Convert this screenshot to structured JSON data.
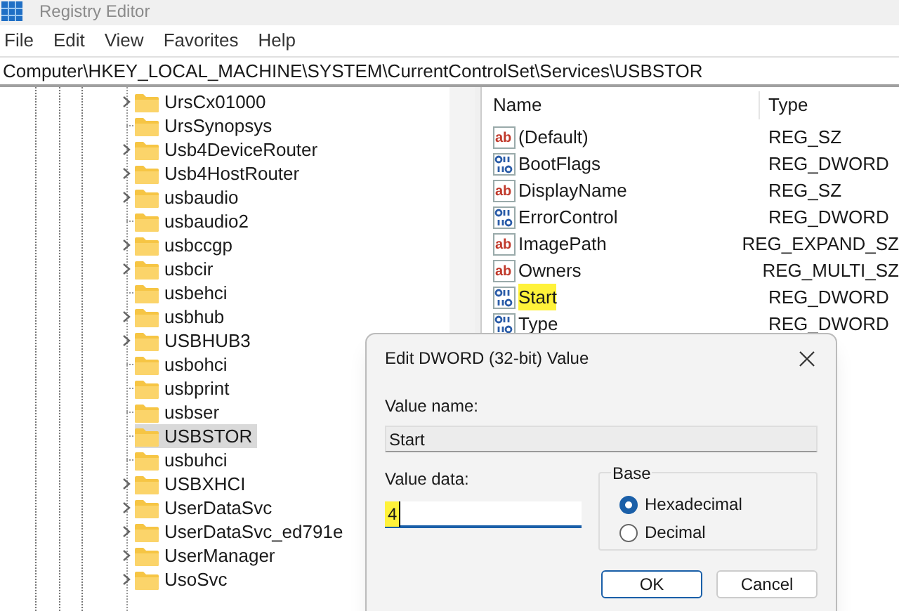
{
  "window": {
    "title": "Registry Editor"
  },
  "menu": [
    "File",
    "Edit",
    "View",
    "Favorites",
    "Help"
  ],
  "address": "Computer\\HKEY_LOCAL_MACHINE\\SYSTEM\\CurrentControlSet\\Services\\USBSTOR",
  "tree": {
    "items": [
      {
        "label": "UrsCx01000",
        "expandable": true,
        "selected": false
      },
      {
        "label": "UrsSynopsys",
        "expandable": false,
        "selected": false
      },
      {
        "label": "Usb4DeviceRouter",
        "expandable": true,
        "selected": false
      },
      {
        "label": "Usb4HostRouter",
        "expandable": true,
        "selected": false
      },
      {
        "label": "usbaudio",
        "expandable": true,
        "selected": false
      },
      {
        "label": "usbaudio2",
        "expandable": false,
        "selected": false
      },
      {
        "label": "usbccgp",
        "expandable": true,
        "selected": false
      },
      {
        "label": "usbcir",
        "expandable": true,
        "selected": false
      },
      {
        "label": "usbehci",
        "expandable": false,
        "selected": false
      },
      {
        "label": "usbhub",
        "expandable": true,
        "selected": false
      },
      {
        "label": "USBHUB3",
        "expandable": true,
        "selected": false
      },
      {
        "label": "usbohci",
        "expandable": false,
        "selected": false
      },
      {
        "label": "usbprint",
        "expandable": false,
        "selected": false
      },
      {
        "label": "usbser",
        "expandable": false,
        "selected": false
      },
      {
        "label": "USBSTOR",
        "expandable": false,
        "selected": true
      },
      {
        "label": "usbuhci",
        "expandable": false,
        "selected": false
      },
      {
        "label": "USBXHCI",
        "expandable": true,
        "selected": false
      },
      {
        "label": "UserDataSvc",
        "expandable": true,
        "selected": false
      },
      {
        "label": "UserDataSvc_ed791e",
        "expandable": true,
        "selected": false
      },
      {
        "label": "UserManager",
        "expandable": true,
        "selected": false
      },
      {
        "label": "UsoSvc",
        "expandable": true,
        "selected": false
      }
    ]
  },
  "values": {
    "columns": [
      "Name",
      "Type"
    ],
    "rows": [
      {
        "kind": "string",
        "icon_text": "ab",
        "name": "(Default)",
        "type": "REG_SZ",
        "highlighted": false
      },
      {
        "kind": "binary",
        "name": "BootFlags",
        "type": "REG_DWORD",
        "highlighted": false
      },
      {
        "kind": "string",
        "icon_text": "ab",
        "name": "DisplayName",
        "type": "REG_SZ",
        "highlighted": false
      },
      {
        "kind": "binary",
        "name": "ErrorControl",
        "type": "REG_DWORD",
        "highlighted": false
      },
      {
        "kind": "string",
        "icon_text": "ab",
        "name": "ImagePath",
        "type": "REG_EXPAND_SZ",
        "highlighted": false
      },
      {
        "kind": "string",
        "icon_text": "ab",
        "name": "Owners",
        "type": "REG_MULTI_SZ",
        "highlighted": false
      },
      {
        "kind": "binary",
        "name": "Start",
        "type": "REG_DWORD",
        "highlighted": true
      },
      {
        "kind": "binary",
        "name": "Type",
        "type": "REG_DWORD",
        "highlighted": false
      }
    ]
  },
  "dialog": {
    "title": "Edit DWORD (32-bit) Value",
    "value_name_label": "Value name:",
    "value_name": "Start",
    "value_data_label": "Value data:",
    "value_data": "4",
    "value_data_highlighted": true,
    "base": {
      "label": "Base",
      "options": [
        {
          "label": "Hexadecimal",
          "selected": true
        },
        {
          "label": "Decimal",
          "selected": false
        }
      ]
    },
    "buttons": [
      {
        "label": "OK",
        "default": true
      },
      {
        "label": "Cancel",
        "default": false
      }
    ]
  }
}
